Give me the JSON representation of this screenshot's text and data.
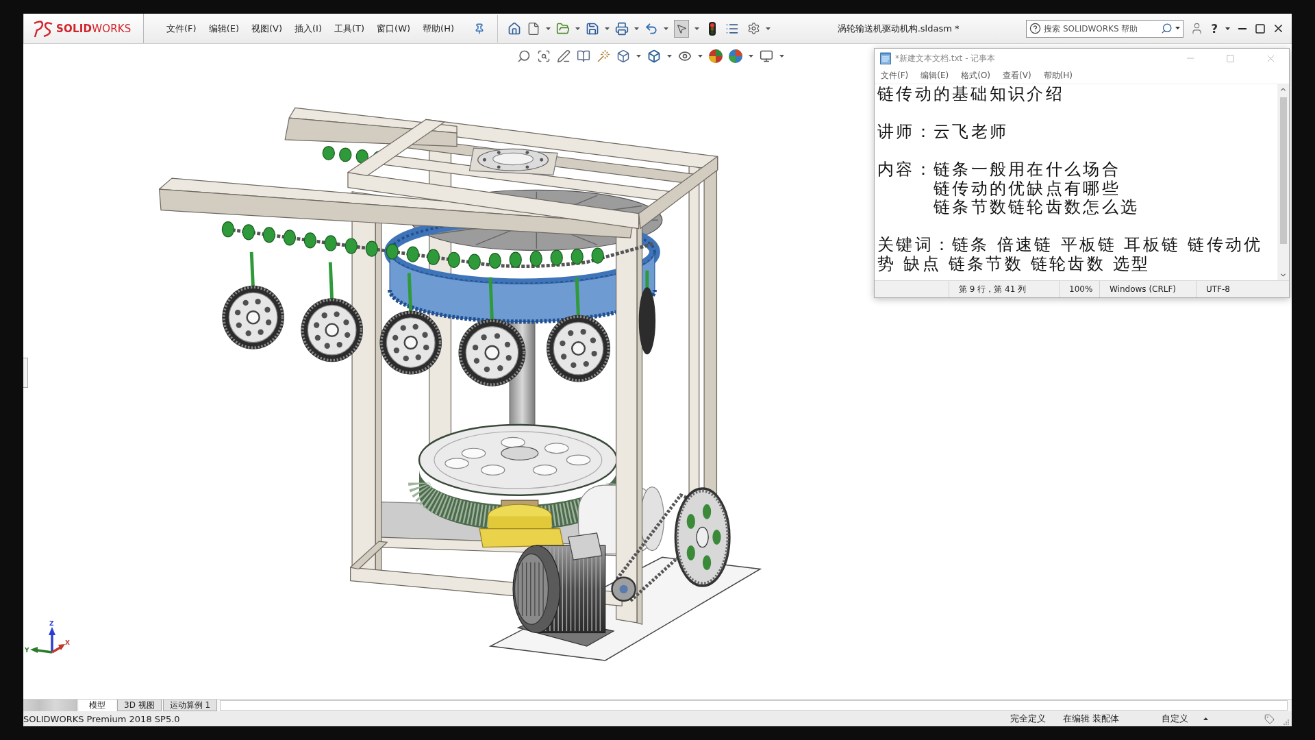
{
  "title_bar": {
    "logo": "**SOLID**WORKS",
    "menu": [
      "文件(F)",
      "编辑(E)",
      "视图(V)",
      "插入(I)",
      "工具(T)",
      "窗口(W)",
      "帮助(H)"
    ],
    "document_title": "涡轮输送机驱动机构.sldasm *",
    "search": {
      "placeholder": "搜索 SOLIDWORKS 帮助"
    },
    "help_button": "?"
  },
  "select_tool": {
    "selected": true
  },
  "triad": [
    {
      "kind": "z",
      "label": "Z"
    },
    {
      "kind": "y",
      "label": "Y"
    },
    {
      "kind": "x",
      "label": "X"
    }
  ],
  "notepad": {
    "title": "*新建文本文档.txt - 记事本",
    "active": false,
    "menu": [
      "文件(F)",
      "编辑(E)",
      "格式(O)",
      "查看(V)",
      "帮助(H)"
    ],
    "document": [
      {
        "kind": "heading",
        "text": "链传动的基础知识介绍"
      },
      {
        "kind": "labeled",
        "label": "讲师：",
        "lines": [
          "云飞老师"
        ]
      },
      {
        "kind": "labeled",
        "label": "内容：",
        "lines": [
          "链条一般用在什么场合",
          "链传动的优缺点有哪些",
          "链条节数链轮齿数怎么选"
        ]
      },
      {
        "kind": "paragraph",
        "text": "关键词：链条 倍速链 平板链 耳板链 链传动优势 缺点 链条节数 链轮齿数 选型"
      }
    ],
    "status": {
      "position": "第 9 行，第 41 列",
      "zoom": "100%",
      "line_endings": "Windows (CRLF)",
      "encoding": "UTF-8"
    }
  },
  "model_tabs": [
    {
      "label": "模型",
      "selected": true
    },
    {
      "label": "3D 视图",
      "selected": false
    },
    {
      "label": "运动算例 1",
      "selected": false
    }
  ],
  "status_bar": {
    "product": "SOLIDWORKS Premium 2018 SP5.0",
    "fields": [
      "完全定义",
      "在编辑 装配体",
      "自定义"
    ]
  }
}
